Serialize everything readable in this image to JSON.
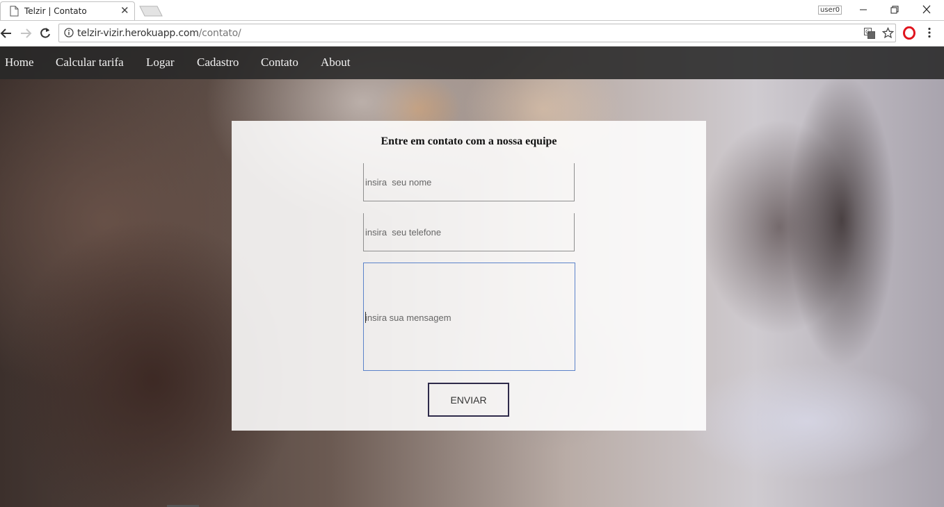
{
  "browser": {
    "tab_title": "Telzir | Contato",
    "url_host": "telzir-vizir.herokuapp.com",
    "url_path": "/contato/",
    "profile_label": "user0"
  },
  "nav": {
    "items": [
      "Home",
      "Calcular tarifa",
      "Logar",
      "Cadastro",
      "Contato",
      "About"
    ]
  },
  "contact_form": {
    "heading": "Entre em contato com a nossa equipe",
    "name_placeholder": "insira  seu nome",
    "phone_placeholder": "insira  seu telefone",
    "message_placeholder": "insira  sua mensagem",
    "submit_label": "ENVIAR"
  },
  "colors": {
    "navbar_bg": "#282828",
    "card_bg": "#ffffff",
    "focus_border": "#5b82c9",
    "button_border": "#2e2a4a"
  }
}
